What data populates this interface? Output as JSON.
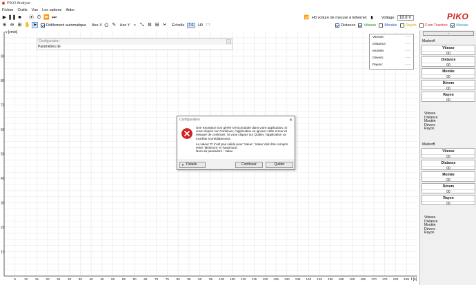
{
  "window": {
    "title": "PIKO Analyse"
  },
  "menu": [
    "Fichier",
    "Outils",
    "Vue",
    "Les options",
    "Aider"
  ],
  "toolbar": {
    "auto_scroll_label": "Défilement automatique",
    "axis_x_label": "Axe X",
    "axis_y_label": "Axe Y",
    "scale_label": "Échelle",
    "scale_options": [
      "1:1",
      "H0",
      "TT"
    ],
    "connection_status": "H0 voiture de mesure à Ethernet",
    "voltage_label": "Voltage:",
    "voltage_value": "18.8 V",
    "brand": "PIKO"
  },
  "series_toggles": [
    {
      "label": "Distance",
      "checked": true,
      "color": "#1a1a1a"
    },
    {
      "label": "Vitesse",
      "checked": true,
      "color": "#1e8c1e"
    },
    {
      "label": "Montée",
      "checked": false,
      "color": "#1a5fd0"
    },
    {
      "label": "Rayon",
      "checked": false,
      "color": "#e0a000"
    },
    {
      "label": "Cran Traction",
      "checked": false,
      "color": "#d02020"
    },
    {
      "label": "Vitesse",
      "checked": true,
      "color": "#20a0a0"
    }
  ],
  "chart_data": {
    "type": "line",
    "ylabel": "v [cm/s]",
    "xlabel": "t [s]",
    "ylim": [
      0,
      100
    ],
    "xlim": [
      0,
      190
    ],
    "y_ticks": [
      10,
      20,
      30,
      40,
      50,
      60,
      70,
      80,
      90
    ],
    "x_ticks": [
      5,
      10,
      15,
      20,
      25,
      30,
      35,
      40,
      45,
      50,
      55,
      60,
      65,
      70,
      75,
      80,
      85,
      90,
      95,
      100,
      105,
      110,
      115,
      120,
      125,
      130,
      135,
      140,
      145,
      150,
      155,
      160,
      165,
      170,
      175,
      180,
      185
    ],
    "grid": true,
    "series": []
  },
  "info_box": {
    "rows": [
      {
        "label": "Vitesse:",
        "value": "- - -"
      },
      {
        "label": "Distance:",
        "value": "- - -"
      },
      {
        "label": "Montée:",
        "value": "- - -"
      },
      {
        "label": "Dévers:",
        "value": "- - -"
      },
      {
        "label": "Rayon:",
        "value": "- - -"
      }
    ]
  },
  "config_panel": {
    "title": "Configuration",
    "subtitle": "Paramètres de"
  },
  "right_panel": {
    "collapse_label": "-",
    "markers": [
      {
        "title": "MarkerA",
        "boxes": [
          {
            "label": "Vitesse",
            "value": "00"
          },
          {
            "label": "Distance",
            "value": "00"
          },
          {
            "label": "Montée",
            "value": "00"
          },
          {
            "label": "Dévers",
            "value": "00"
          },
          {
            "label": "Rayon",
            "value": "00"
          }
        ],
        "list": [
          "Vitesse",
          "Distance",
          "Montée",
          "Dévers",
          "Rayon"
        ]
      },
      {
        "title": "MarkerB",
        "boxes": [
          {
            "label": "Vitesse",
            "value": "00"
          },
          {
            "label": "Distance",
            "value": "00"
          },
          {
            "label": "Montée",
            "value": "00"
          },
          {
            "label": "Dévers",
            "value": "00"
          },
          {
            "label": "Rayon",
            "value": "00"
          }
        ],
        "list": [
          "Vitesse",
          "Distance",
          "Montée",
          "Dévers",
          "Rayon"
        ]
      }
    ]
  },
  "dialog": {
    "title": "Configuration",
    "message1": "Une exception non gérée s'est produite dans votre application. Si vous cliquez sur Continuer, l'application va ignorer cette erreur et essayer de continuer. Si vous cliquez sur Quitter, l'application va s'arrêter immédiatement.",
    "message2": "La valeur '0' n'est pas valide pour 'Value'. 'Value' doit être compris entre 'Minimum' et 'Maximum'.",
    "message3": "Nom du paramètre : Value",
    "details_label": "Détails",
    "continue_label": "Continuer",
    "quit_label": "Quitter"
  }
}
